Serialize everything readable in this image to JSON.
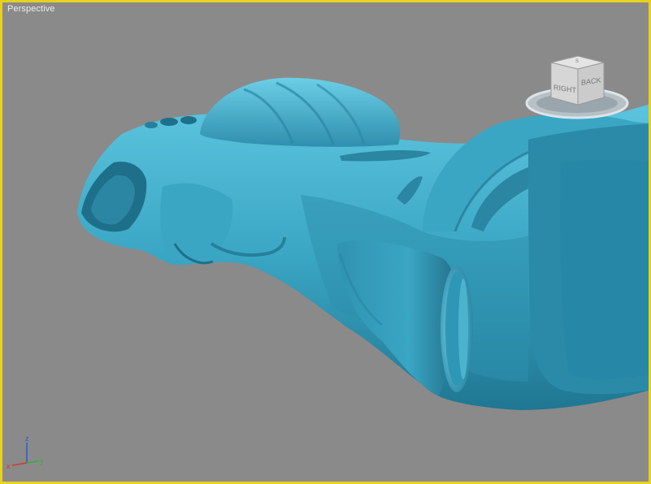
{
  "viewport": {
    "label": "Perspective",
    "border_color": "#e6d21e",
    "background": "#8a8a8a",
    "model_color": "#3aa6c4"
  },
  "viewcube": {
    "face_right": "RIGHT",
    "face_back": "BACK",
    "face_top": "S",
    "icon": "viewcube-icon"
  },
  "axis": {
    "x": "x",
    "y": "y",
    "z": "z",
    "x_color": "#d23a2a",
    "y_color": "#2ab43a",
    "z_color": "#2a5ad2"
  }
}
